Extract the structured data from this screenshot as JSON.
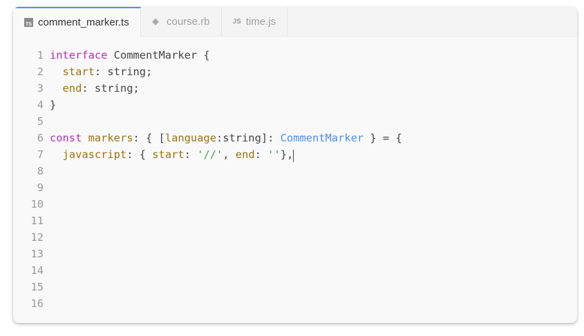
{
  "tabs": [
    {
      "label": "comment_marker.ts",
      "icon": "typescript-icon",
      "icon_text": "TS",
      "active": true
    },
    {
      "label": "course.rb",
      "icon": "ruby-icon",
      "active": false
    },
    {
      "label": "time.js",
      "icon": "javascript-icon",
      "icon_text": "JS",
      "active": false
    }
  ],
  "editor": {
    "lines": [
      [
        [
          "interface ",
          "kw"
        ],
        [
          "CommentMarker {",
          "plain"
        ]
      ],
      [
        [
          "  start",
          "prop"
        ],
        [
          ": string;",
          "plain"
        ]
      ],
      [
        [
          "  end",
          "prop"
        ],
        [
          ": string;",
          "plain"
        ]
      ],
      [
        [
          "}",
          "plain"
        ]
      ],
      [],
      [
        [
          "const ",
          "kw"
        ],
        [
          "markers",
          "prop"
        ],
        [
          ": { [",
          "plain"
        ],
        [
          "language",
          "prop"
        ],
        [
          ":string]: ",
          "plain"
        ],
        [
          "CommentMarker",
          "type"
        ],
        [
          " } = {",
          "plain"
        ]
      ],
      [
        [
          "  javascript",
          "prop"
        ],
        [
          ": { ",
          "plain"
        ],
        [
          "start",
          "prop"
        ],
        [
          ": ",
          "plain"
        ],
        [
          "'//'",
          "str"
        ],
        [
          ", ",
          "plain"
        ],
        [
          "end",
          "prop"
        ],
        [
          ": ",
          "plain"
        ],
        [
          "''",
          "str"
        ],
        [
          "},",
          "plain"
        ]
      ],
      [],
      [],
      [],
      [],
      [],
      [],
      [],
      [],
      []
    ],
    "cursor_line": 7
  }
}
